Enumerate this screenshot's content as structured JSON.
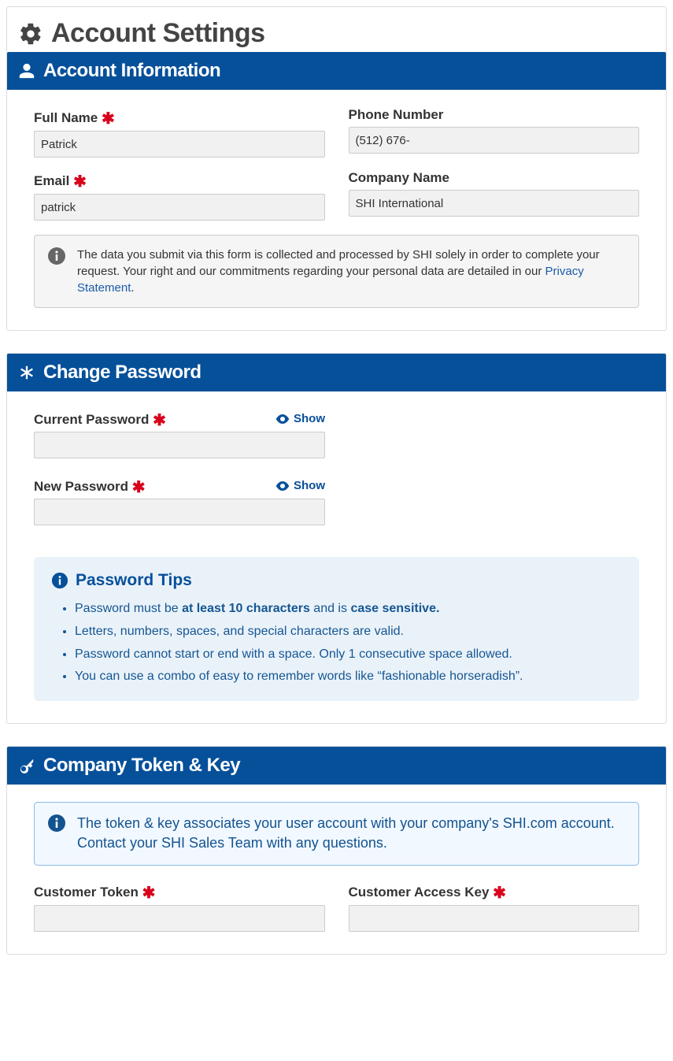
{
  "page": {
    "title": "Account Settings"
  },
  "account": {
    "header": "Account Information",
    "fullname_label": "Full Name",
    "fullname_value": "Patrick",
    "phone_label": "Phone Number",
    "phone_value": "(512) 676-",
    "email_label": "Email",
    "email_value": "patrick",
    "company_label": "Company Name",
    "company_value": "SHI International",
    "privacy_text": "The data you submit via this form is collected and processed by SHI solely in order to complete your request. Your right and our commitments regarding your personal data are detailed in our ",
    "privacy_link": "Privacy Statement",
    "privacy_suffix": "."
  },
  "password": {
    "header": "Change Password",
    "current_label": "Current Password",
    "new_label": "New Password",
    "show_label": "Show",
    "tips_header": "Password Tips",
    "tip1_prefix": "Password must be ",
    "tip1_bold1": "at least 10 characters",
    "tip1_mid": " and is ",
    "tip1_bold2": "case sensitive.",
    "tip2": "Letters, numbers, spaces, and special characters are valid.",
    "tip3": "Password cannot start or end with a space. Only 1 consecutive space allowed.",
    "tip4": "You can use a combo of easy to remember words like “fashionable horseradish”."
  },
  "token": {
    "header": "Company Token & Key",
    "info": "The token & key associates your user account with your company's SHI.com account. Contact your SHI Sales Team with any questions.",
    "token_label": "Customer Token",
    "key_label": "Customer Access Key"
  }
}
